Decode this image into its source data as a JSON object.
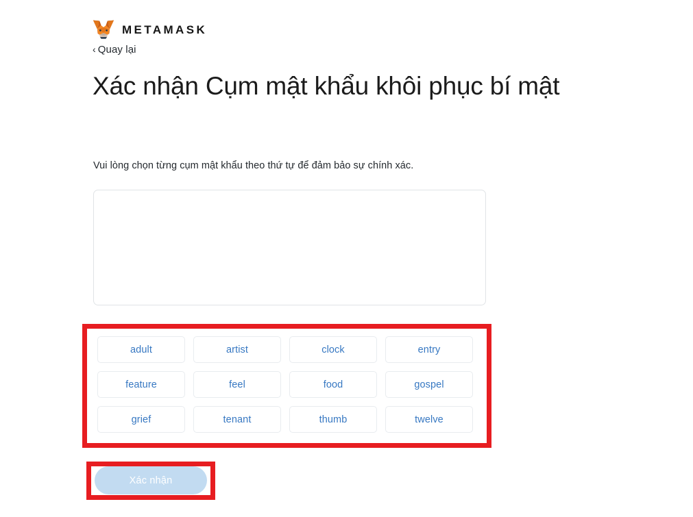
{
  "brand": {
    "logo_icon": "metamask-fox-icon",
    "wordmark": "METAMASK"
  },
  "navigation": {
    "back_chevron": "‹",
    "back_label": "Quay lại"
  },
  "header": {
    "title": "Xác nhận Cụm mật khẩu khôi phục bí mật",
    "subtitle": "Vui lòng chọn từng cụm mật khẩu theo thứ tự để đảm bảo sự chính xác."
  },
  "dropzone": {
    "value": "",
    "placeholder": ""
  },
  "word_bank": {
    "words": [
      "adult",
      "artist",
      "clock",
      "entry",
      "feature",
      "feel",
      "food",
      "gospel",
      "grief",
      "tenant",
      "thumb",
      "twelve"
    ]
  },
  "actions": {
    "confirm_label": "Xác nhận",
    "confirm_disabled": true
  },
  "colors": {
    "accent_blue": "#3778c2",
    "button_disabled": "#c2dbf1",
    "annotation_red": "#e71d21",
    "fox_orange": "#e2761b",
    "fox_dark": "#763d16"
  }
}
